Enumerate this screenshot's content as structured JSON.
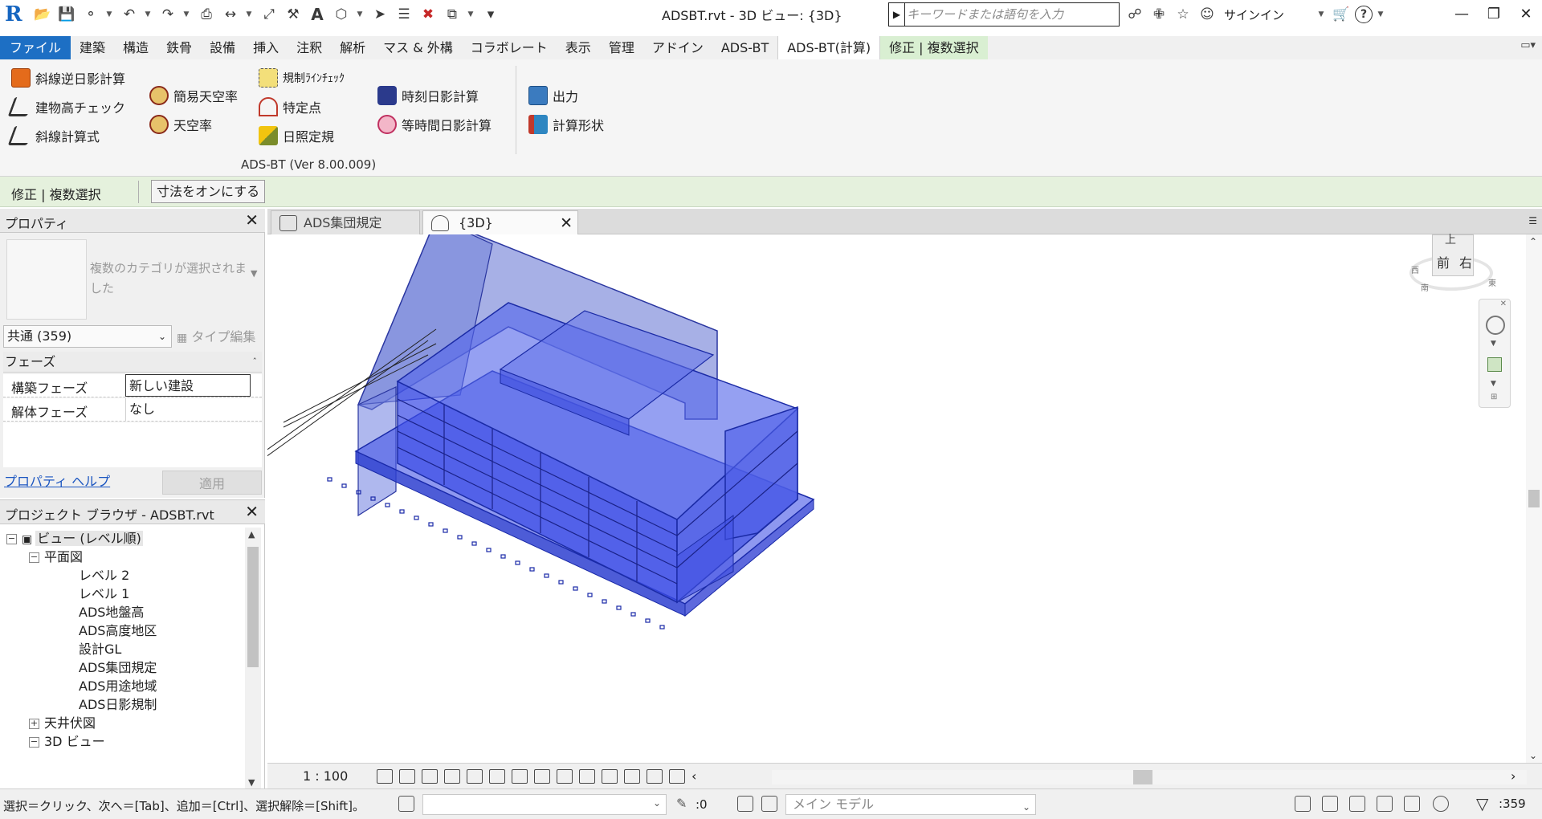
{
  "title_bar": {
    "app_logo": "R",
    "window_title": "ADSBT.rvt - 3D ビュー: {3D}",
    "search_placeholder": "キーワードまたは語句を入力",
    "signin_label": "サインイン",
    "quick_access_icons": [
      "open-icon",
      "save-icon",
      "sync-icon",
      "undo-icon",
      "redo-icon",
      "print-icon",
      "measure-icon",
      "dimension-icon",
      "tag-icon",
      "text-icon",
      "3d-view-icon",
      "section-icon",
      "thin-lines-icon",
      "close-hidden-icon",
      "switch-windows-icon",
      "customize-icon"
    ]
  },
  "ribbon": {
    "tabs": [
      {
        "label": "ファイル",
        "kind": "file"
      },
      {
        "label": "建築"
      },
      {
        "label": "構造"
      },
      {
        "label": "鉄骨"
      },
      {
        "label": "設備"
      },
      {
        "label": "挿入"
      },
      {
        "label": "注釈"
      },
      {
        "label": "解析"
      },
      {
        "label": "マス & 外構"
      },
      {
        "label": "コラボレート"
      },
      {
        "label": "表示"
      },
      {
        "label": "管理"
      },
      {
        "label": "アドイン"
      },
      {
        "label": "ADS-BT"
      },
      {
        "label": "ADS-BT(計算)",
        "kind": "active"
      },
      {
        "label": "修正 | 複数選択",
        "kind": "context"
      }
    ],
    "panel_label": "ADS-BT  (Ver 8.00.009)",
    "buttons": {
      "slant_reverse_shadow": "斜線逆日影計算",
      "building_height_check": "建物高チェック",
      "slant_formula": "斜線計算式",
      "simple_sky_factor": "簡易天空率",
      "sky_factor": "天空率",
      "regulation_line_check": "規制ﾗｲﾝﾁｪｯｸ",
      "specific_point": "特定点",
      "sunlight_regulation": "日照定規",
      "timed_shadow": "時刻日影計算",
      "isochronal_shadow": "等時間日影計算",
      "output": "出力",
      "calc_shape": "計算形状"
    }
  },
  "options_bar": {
    "title": "修正 | 複数選択",
    "dimension_toggle": "寸法をオンにする"
  },
  "properties": {
    "title": "プロパティ",
    "type_name": "複数のカテゴリが選択されました",
    "category_filter": "共通 (359)",
    "edit_type": "タイプ編集",
    "group_phase": "フェーズ",
    "rows": [
      {
        "label": "構築フェーズ",
        "value": "新しい建設"
      },
      {
        "label": "解体フェーズ",
        "value": "なし"
      }
    ],
    "help_link": "プロパティ ヘルプ",
    "apply_button": "適用"
  },
  "project_browser": {
    "title": "プロジェクト ブラウザ - ADSBT.rvt",
    "views_root": "ビュー (レベル順)",
    "floor_plans": "平面図",
    "floor_plan_items": [
      "レベル 2",
      "レベル 1",
      "ADS地盤高",
      "ADS高度地区",
      "設計GL",
      "ADS集団規定",
      "ADS用途地域",
      "ADS日影規制"
    ],
    "ceiling_plans": "天井伏図",
    "views_3d": "3D ビュー"
  },
  "view_tabs": [
    {
      "label": "ADS集団規定"
    },
    {
      "label": "{3D}"
    }
  ],
  "view_cube": {
    "top": "上",
    "front": "前",
    "right": "右",
    "compass_south": "南",
    "compass_east": "東",
    "compass_west": "西"
  },
  "view_control": {
    "scale": "1 : 100"
  },
  "status_bar": {
    "text": "選択＝クリック、次へ＝[Tab]、追加＝[Ctrl]、選択解除＝[Shift]。",
    "selected_count_editable": ":0",
    "model_field": "メイン モデル",
    "filter_count": ":359"
  },
  "colors": {
    "model_fill": "#3344ee",
    "ribbon_file_tab": "#1d6fc4",
    "context_tab": "#d9efd2",
    "options_bar": "#e5f1dd"
  }
}
